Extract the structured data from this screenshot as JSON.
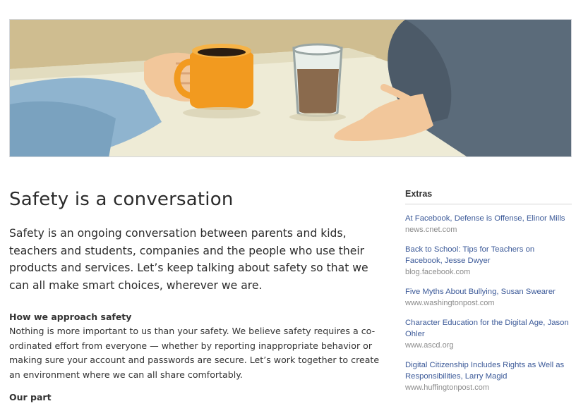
{
  "hero": {
    "illustration": "two-people-talking-over-coffee"
  },
  "page": {
    "title": "Safety is a conversation",
    "intro": "Safety is an ongoing conversation between parents and kids, teachers and students, companies and the people who use their products and services. Let’s keep talking about safety so that we can all make smart choices, wherever we are."
  },
  "sections": [
    {
      "heading": "How we approach safety",
      "body": "Nothing is more important to us than your safety. We believe safety requires a co-ordinated effort from everyone — whether by reporting inappropriate behavior or making sure your account and passwords are secure. Let’s work together to create an environment where we can all share comfortably."
    },
    {
      "heading": "Our part"
    }
  ],
  "sidebar": {
    "title": "Extras",
    "items": [
      {
        "label": "At Facebook, Defense is Offense, Elinor Mills",
        "source": "news.cnet.com"
      },
      {
        "label": "Back to School: Tips for Teachers on Facebook, Jesse Dwyer",
        "source": "blog.facebook.com"
      },
      {
        "label": "Five Myths About Bullying, Susan Swearer",
        "source": "www.washingtonpost.com"
      },
      {
        "label": "Character Education for the Digital Age, Jason Ohler",
        "source": "www.ascd.org"
      },
      {
        "label": "Digital Citizenship Includes Rights as Well as Responsibilities, Larry Magid",
        "source": "www.huffingtonpost.com"
      }
    ]
  },
  "colors": {
    "link": "#3b5998",
    "mug": "#f29a1f",
    "table": "#eeebd6",
    "sleeve_left": "#8fb4cf",
    "sleeve_right": "#5b6b7a",
    "skin": "#f2c79b"
  }
}
